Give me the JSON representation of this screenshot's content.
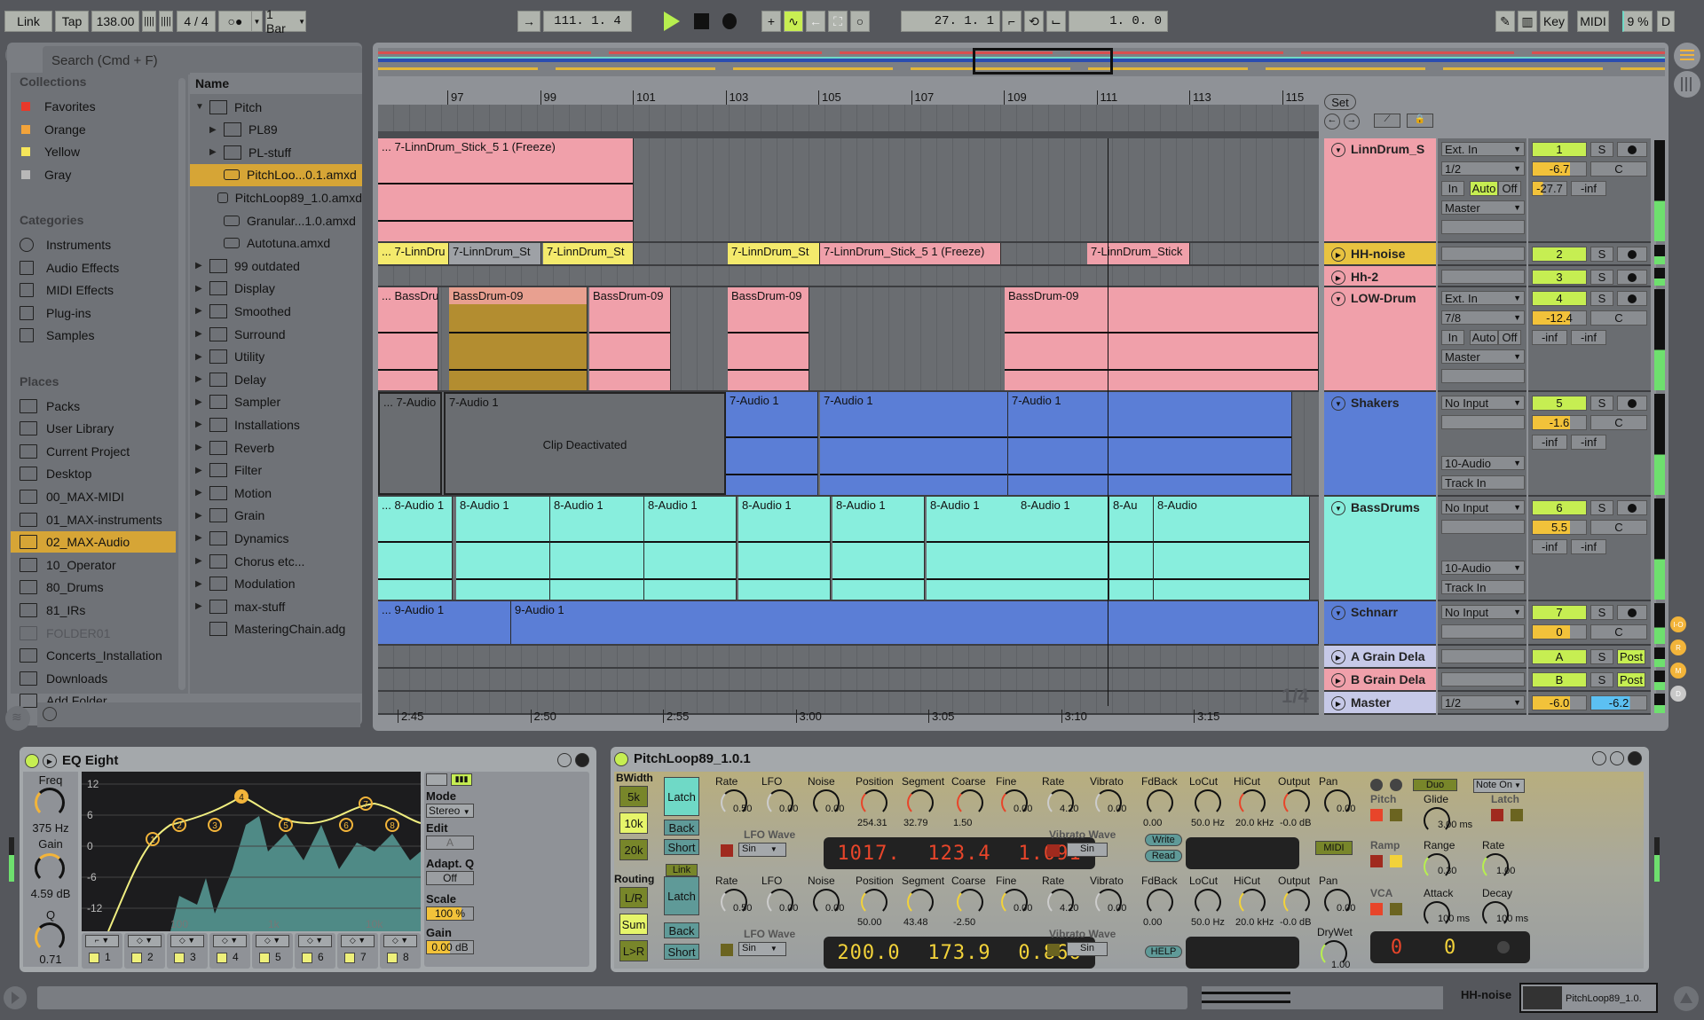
{
  "transport": {
    "link": "Link",
    "tap": "Tap",
    "tempo": "138.00",
    "time_signature": "4 / 4",
    "quantize": "1 Bar",
    "arrangement_position": "111. 1. 4",
    "loop_start": "27. 1. 1",
    "loop_length": "1. 0. 0",
    "key": "Key",
    "midi": "MIDI",
    "cpu": "9 %",
    "d": "D"
  },
  "browser": {
    "search_placeholder": "Search (Cmd + F)",
    "collections_header": "Collections",
    "collections": [
      {
        "label": "Favorites",
        "color": "#e8392a"
      },
      {
        "label": "Orange",
        "color": "#f2a33a"
      },
      {
        "label": "Yellow",
        "color": "#f6e65a"
      },
      {
        "label": "Gray",
        "color": "#b8b8b8"
      }
    ],
    "categories_header": "Categories",
    "categories": [
      "Instruments",
      "Audio Effects",
      "MIDI Effects",
      "Plug-ins",
      "Samples"
    ],
    "places_header": "Places",
    "places": [
      "Packs",
      "User Library",
      "Current Project",
      "Desktop",
      "00_MAX-MIDI",
      "01_MAX-instruments",
      "02_MAX-Audio",
      "10_Operator",
      "80_Drums",
      "81_IRs",
      "FOLDER01",
      "Concerts_Installation",
      "Downloads",
      "Add Folder..."
    ],
    "selected_place": "02_MAX-Audio",
    "name_header": "Name",
    "tree": [
      {
        "label": "Pitch",
        "type": "folder",
        "expanded": true,
        "indent": 0
      },
      {
        "label": "PL89",
        "type": "folder",
        "indent": 1
      },
      {
        "label": "PL-stuff",
        "type": "folder",
        "indent": 1
      },
      {
        "label": "PitchLoo...0.1.amxd",
        "type": "device",
        "indent": 1,
        "selected": true
      },
      {
        "label": "PitchLoop89_1.0.amxd",
        "type": "device",
        "indent": 1
      },
      {
        "label": "Granular...1.0.amxd",
        "type": "device",
        "indent": 1
      },
      {
        "label": "Autotuna.amxd",
        "type": "device",
        "indent": 1
      },
      {
        "label": "99 outdated",
        "type": "folder",
        "indent": 0
      },
      {
        "label": "Display",
        "type": "folder",
        "indent": 0
      },
      {
        "label": "Smoothed",
        "type": "folder",
        "indent": 0
      },
      {
        "label": "Surround",
        "type": "folder",
        "indent": 0
      },
      {
        "label": "Utility",
        "type": "folder",
        "indent": 0
      },
      {
        "label": "Delay",
        "type": "folder",
        "indent": 0
      },
      {
        "label": "Sampler",
        "type": "folder",
        "indent": 0
      },
      {
        "label": "Installations",
        "type": "folder",
        "indent": 0
      },
      {
        "label": "Reverb",
        "type": "folder",
        "indent": 0
      },
      {
        "label": "Filter",
        "type": "folder",
        "indent": 0
      },
      {
        "label": "Motion",
        "type": "folder",
        "indent": 0
      },
      {
        "label": "Grain",
        "type": "folder",
        "indent": 0
      },
      {
        "label": "Dynamics",
        "type": "folder",
        "indent": 0
      },
      {
        "label": "Chorus etc...",
        "type": "folder",
        "indent": 0
      },
      {
        "label": "Modulation",
        "type": "folder",
        "indent": 0
      },
      {
        "label": "max-stuff",
        "type": "folder",
        "indent": 0
      },
      {
        "label": "MasteringChain.adg",
        "type": "rack",
        "indent": 0
      }
    ]
  },
  "arrangement": {
    "bar_markers": [
      "97",
      "99",
      "101",
      "103",
      "105",
      "107",
      "109",
      "111",
      "113",
      "115"
    ],
    "time_markers": [
      "2:45",
      "2:50",
      "2:55",
      "3:00",
      "3:05",
      "3:10",
      "3:15"
    ],
    "grid": "1/4",
    "set_label": "Set",
    "clip_deactivated": "Clip Deactivated"
  },
  "tracks": [
    {
      "name": "LinnDrum_S",
      "color": "#f0a0aa",
      "input": "Ext. In",
      "channel": "1/2",
      "monitor": [
        "In",
        "Auto",
        "Off"
      ],
      "monitor_active": "Auto",
      "output": "Master",
      "number": "1",
      "volume": "-6.7",
      "pan": "C",
      "sendA": "-27.7",
      "sendB": "-inf",
      "expanded": true,
      "clips": [
        {
          "label": "... 7-LinnDrum_Stick_5 1 (Freeze)"
        }
      ]
    },
    {
      "name": "HH-noise",
      "color": "#e8c340",
      "number": "2",
      "expanded": false,
      "clips": [
        {
          "label": "... 7-LinnDru"
        },
        {
          "label": "7-LinnDrum_St"
        },
        {
          "label": "7-LinnDrum_St"
        },
        {
          "label": "7-LinnDrum_St"
        },
        {
          "label": "7-LinnDrum_Stick_5 1 (Freeze)"
        },
        {
          "label": "7-LinnDrum_Stick"
        }
      ]
    },
    {
      "name": "Hh-2",
      "color": "#f0a0aa",
      "number": "3",
      "expanded": false,
      "clips": []
    },
    {
      "name": "LOW-Drum",
      "color": "#f0a0aa",
      "input": "Ext. In",
      "channel": "7/8",
      "monitor": [
        "In",
        "Auto",
        "Off"
      ],
      "output": "Master",
      "number": "4",
      "volume": "-12.4",
      "pan": "C",
      "sendA": "-inf",
      "sendB": "-inf",
      "expanded": true,
      "clips": [
        {
          "label": "... BassDru"
        },
        {
          "label": "BassDrum-09"
        },
        {
          "label": "BassDrum-09"
        },
        {
          "label": "BassDrum-09"
        },
        {
          "label": "BassDrum-09"
        }
      ]
    },
    {
      "name": "Shakers",
      "color": "#5b7ed6",
      "input": "No Input",
      "output": "10-Audio",
      "output_sub": "Track In",
      "number": "5",
      "volume": "-1.6",
      "pan": "C",
      "sendA": "-inf",
      "sendB": "-inf",
      "expanded": true,
      "clips": [
        {
          "label": "... 7-Audio"
        },
        {
          "label": "7-Audio 1"
        },
        {
          "label": "7-Audio 1"
        },
        {
          "label": "7-Audio 1"
        },
        {
          "label": "7-Audio 1"
        }
      ]
    },
    {
      "name": "BassDrums",
      "color": "#88eedd",
      "input": "No Input",
      "output": "10-Audio",
      "output_sub": "Track In",
      "number": "6",
      "volume": "5.5",
      "pan": "C",
      "sendA": "-inf",
      "sendB": "-inf",
      "expanded": true,
      "clips": [
        {
          "label": "... 8-Audio 1"
        },
        {
          "label": "8-Audio 1"
        },
        {
          "label": "8-Audio 1"
        },
        {
          "label": "8-Audio 1"
        },
        {
          "label": "8-Audio 1"
        },
        {
          "label": "8-Audio 1"
        },
        {
          "label": "8-Audio 1"
        },
        {
          "label": "8-Audio 1"
        },
        {
          "label": "8-Au"
        },
        {
          "label": "8-Audio"
        }
      ]
    },
    {
      "name": "Schnarr",
      "color": "#5b7ed6",
      "input": "No Input",
      "number": "7",
      "volume": "0",
      "pan": "C",
      "expanded": true,
      "clips": [
        {
          "label": "... 9-Audio 1"
        },
        {
          "label": "9-Audio 1"
        }
      ]
    },
    {
      "name": "A Grain Dela",
      "color": "#c6c9e8",
      "number": "A",
      "post": "Post",
      "expanded": false,
      "clips": []
    },
    {
      "name": "B Grain Dela",
      "color": "#f0a0aa",
      "number": "B",
      "post": "Post",
      "expanded": false,
      "clips": []
    },
    {
      "name": "Master",
      "color": "#c6c9e8",
      "channel": "1/2",
      "volume": "-6.0",
      "pan": "-6.2",
      "expanded": false,
      "clips": []
    }
  ],
  "mixer_labels": {
    "solo": "S"
  },
  "side_buttons": [
    "I-O",
    "R",
    "M",
    "D"
  ],
  "eq_eight": {
    "title": "EQ Eight",
    "freq_label": "Freq",
    "freq_value": "375 Hz",
    "gain_label": "Gain",
    "gain_value": "4.59 dB",
    "q_label": "Q",
    "q_value": "0.71",
    "y_ticks": [
      "12",
      "6",
      "0",
      "-6",
      "-12"
    ],
    "x_ticks": [
      "100",
      "1k",
      "10k"
    ],
    "bands": [
      "1",
      "2",
      "3",
      "4",
      "5",
      "6",
      "7",
      "8"
    ],
    "selected_band": "4",
    "mode_label": "Mode",
    "mode_value": "Stereo",
    "edit_label": "Edit",
    "edit_value": "A",
    "adaptq_label": "Adapt. Q",
    "adaptq_value": "Off",
    "scale_label": "Scale",
    "scale_value": "100 %",
    "out_gain_label": "Gain",
    "out_gain_value": "0.00 dB"
  },
  "pitchloop": {
    "title": "PitchLoop89_1.0.1",
    "bwidth_label": "BWidth",
    "bwidth_options": [
      "5k",
      "10k",
      "20k"
    ],
    "bwidth_selected": "10k",
    "routing_label": "Routing",
    "routing_options": [
      "L/R",
      "Sum",
      "L>R"
    ],
    "routing_selected": "Sum",
    "link_label": "Link",
    "voices": [
      {
        "latch": "Latch",
        "back": "Back",
        "short": "Short",
        "rate": "0.50",
        "lfo": "0.00",
        "noise": "0.00",
        "position": "254.31",
        "segment": "32.79",
        "coarse": "1.50",
        "fine": "0.00",
        "vib_rate": "4.20",
        "vibrato": "0.00",
        "fdback": "0.00",
        "locut": "50.0 Hz",
        "hicut": "20.0 kHz",
        "output": "-0.0 dB",
        "pan": "0.00",
        "lfo_wave": "Sin",
        "vibrato_wave": "Sin",
        "lcd": [
          "1017.",
          "123.4",
          "1.091"
        ],
        "color": "#e8452a"
      },
      {
        "latch": "Latch",
        "back": "Back",
        "short": "Short",
        "rate": "0.50",
        "lfo": "0.00",
        "noise": "0.00",
        "position": "50.00",
        "segment": "43.48",
        "coarse": "-2.50",
        "fine": "0.00",
        "vib_rate": "4.20",
        "vibrato": "0.00",
        "fdback": "0.00",
        "locut": "50.0 Hz",
        "hicut": "20.0 kHz",
        "output": "-0.0 dB",
        "pan": "0.00",
        "lfo_wave": "Sin",
        "vibrato_wave": "Sin",
        "lcd": [
          "200.0",
          "173.9",
          "0.866"
        ],
        "color": "#f2d23a"
      }
    ],
    "param_labels": {
      "rate": "Rate",
      "lfo": "LFO",
      "noise": "Noise",
      "position": "Position",
      "segment": "Segment",
      "coarse": "Coarse",
      "fine": "Fine",
      "vibrato": "Vibrato",
      "fdback": "FdBack",
      "locut": "LoCut",
      "hicut": "HiCut",
      "output": "Output",
      "pan": "Pan",
      "lfo_wave": "LFO Wave",
      "vibrato_wave": "Vibrato Wave",
      "drywet": "DryWet"
    },
    "write": "Write",
    "read": "Read",
    "help": "HELP",
    "midi": "MIDI",
    "drywet_value": "1.00",
    "duo": "Duo",
    "note_mode": "Note On",
    "pitch": "Pitch",
    "ramp": "Ramp",
    "vca": "VCA",
    "latch": "Latch",
    "glide_label": "Glide",
    "glide_value": "3.00 ms",
    "range_label": "Range",
    "range_value": "0.30",
    "mod_rate_label": "Rate",
    "mod_rate_value": "1.00",
    "attack_label": "Attack",
    "attack_value": "100 ms",
    "decay_label": "Decay",
    "decay_value": "100 ms",
    "lcd_right": [
      "0",
      "0"
    ]
  },
  "statusbar": {
    "track": "HH-noise",
    "device": "PitchLoop89_1.0."
  }
}
